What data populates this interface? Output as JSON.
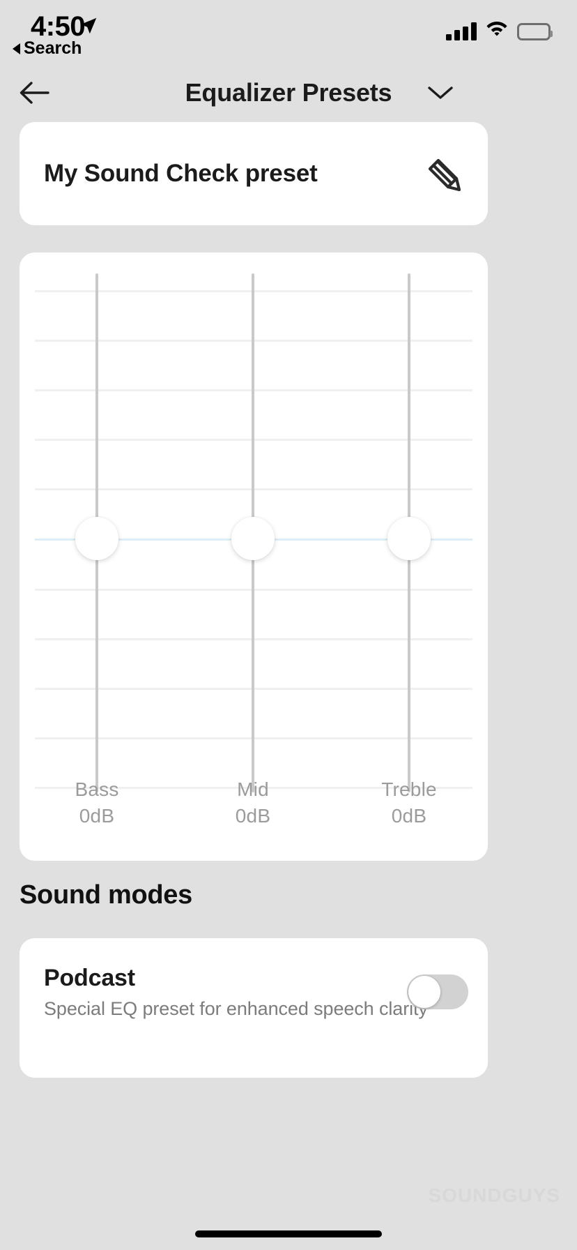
{
  "status_bar": {
    "time": "4:50",
    "location_icon": "location-arrow-icon",
    "back_label": "Search",
    "cellular_icon": "cellular-signal-icon",
    "wifi_icon": "wifi-icon",
    "battery_icon": "battery-full-icon"
  },
  "navbar": {
    "back_icon": "arrow-left-icon",
    "title": "Equalizer Presets",
    "chevron_icon": "chevron-down-icon"
  },
  "preset": {
    "name": "My Sound Check preset",
    "edit_icon": "pencil-icon"
  },
  "equalizer": {
    "bands": [
      {
        "name": "Bass",
        "value_label": "0dB",
        "value_db": 0
      },
      {
        "name": "Mid",
        "value_label": "0dB",
        "value_db": 0
      },
      {
        "name": "Treble",
        "value_label": "0dB",
        "value_db": 0
      }
    ],
    "zero_line_color": "#dceef6",
    "track_color": "#c9c9c9",
    "grid_color": "#f0f0f0"
  },
  "sound_modes": {
    "heading": "Sound modes",
    "items": [
      {
        "title": "Podcast",
        "subtitle": "Special EQ preset for enhanced speech clarity",
        "enabled": false
      }
    ]
  },
  "watermark": {
    "text": "SOUNDGUYS"
  }
}
